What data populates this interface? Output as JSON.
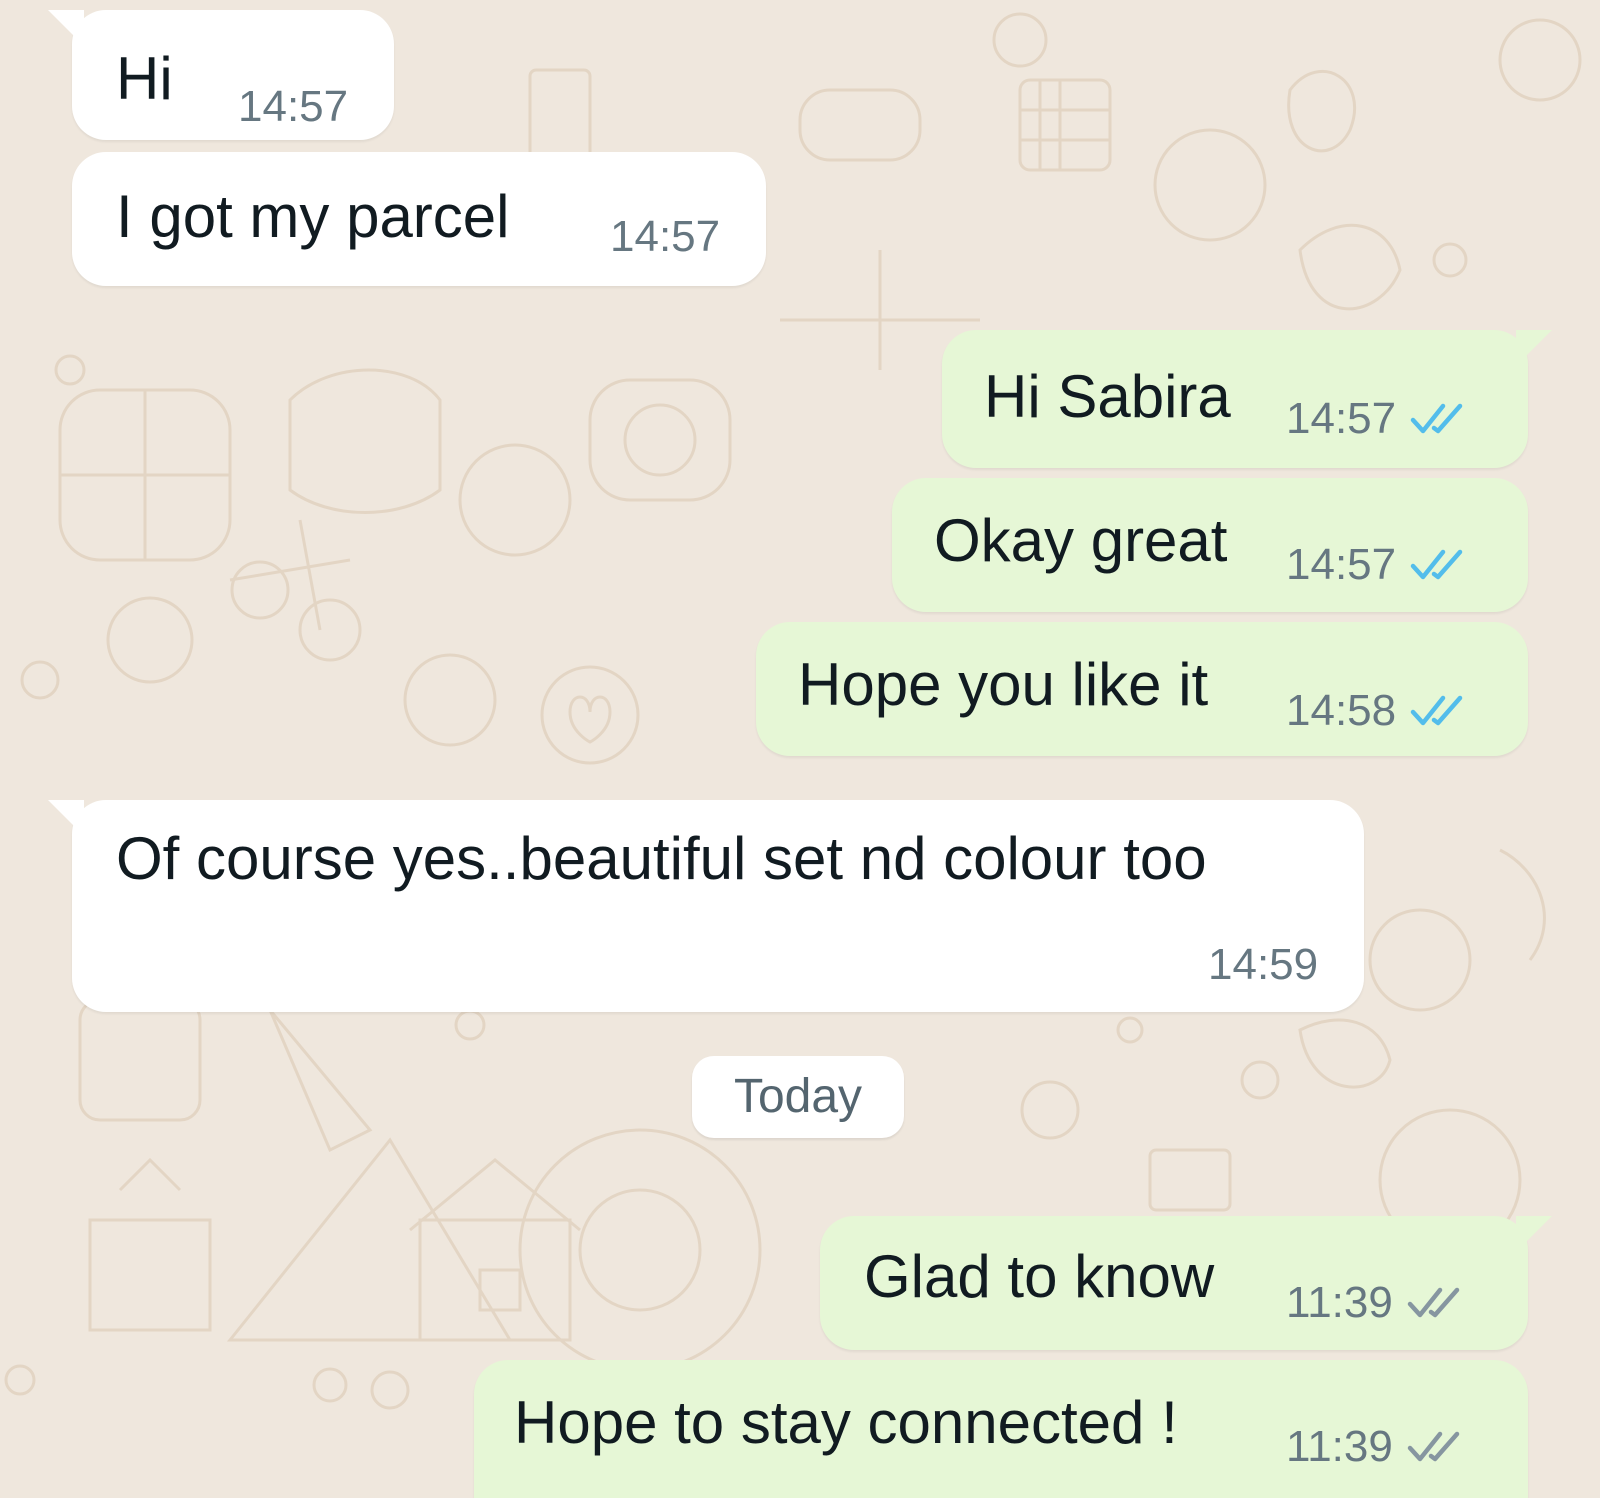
{
  "chat": {
    "messages": [
      {
        "direction": "incoming",
        "text": "Hi",
        "time": "14:57"
      },
      {
        "direction": "incoming",
        "text": "I got my parcel",
        "time": "14:57"
      },
      {
        "direction": "outgoing",
        "text": "Hi Sabira",
        "time": "14:57",
        "status": "read"
      },
      {
        "direction": "outgoing",
        "text": "Okay great",
        "time": "14:57",
        "status": "read"
      },
      {
        "direction": "outgoing",
        "text": "Hope you like it",
        "time": "14:58",
        "status": "read"
      },
      {
        "direction": "incoming",
        "text": "Of course yes..beautiful set nd colour too",
        "time": "14:59"
      },
      {
        "direction": "outgoing",
        "text": "Glad to know",
        "time": "11:39",
        "status": "delivered"
      },
      {
        "direction": "outgoing",
        "text": "Hope to stay connected !",
        "time": "11:39",
        "status": "delivered"
      }
    ],
    "date_separator": "Today"
  },
  "colors": {
    "wallpaper": "#efe7dd",
    "incoming_bubble": "#ffffff",
    "outgoing_bubble": "#e6f7d6",
    "read_tick": "#53bdeb",
    "delivered_tick": "#8696a0",
    "timestamp": "#667781"
  },
  "icons": {
    "read_status": "double-check-icon",
    "delivered_status": "double-check-icon"
  }
}
